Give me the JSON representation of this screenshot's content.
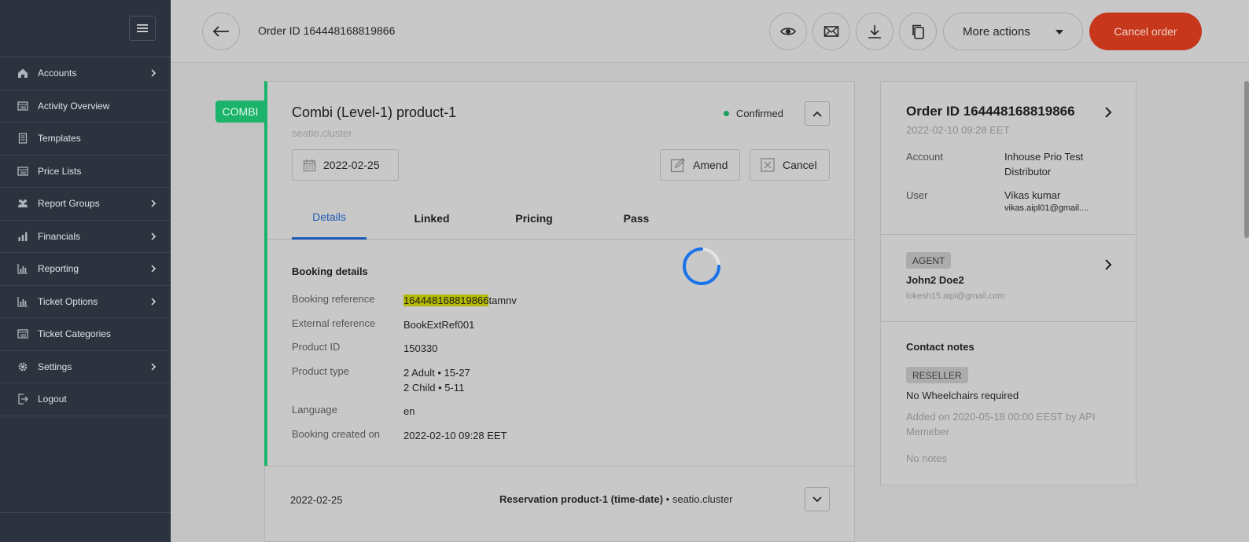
{
  "sidebar": {
    "items": [
      {
        "label": "Accounts",
        "icon": "home-icon",
        "has_children": true
      },
      {
        "label": "Activity Overview",
        "icon": "list-icon",
        "has_children": false
      },
      {
        "label": "Templates",
        "icon": "document-icon",
        "has_children": false
      },
      {
        "label": "Price Lists",
        "icon": "list-icon",
        "has_children": false
      },
      {
        "label": "Report Groups",
        "icon": "users-icon",
        "has_children": true
      },
      {
        "label": "Financials",
        "icon": "bar-chart-icon",
        "has_children": true
      },
      {
        "label": "Reporting",
        "icon": "chart-icon",
        "has_children": true
      },
      {
        "label": "Ticket Options",
        "icon": "chart-icon",
        "has_children": true
      },
      {
        "label": "Ticket Categories",
        "icon": "list-icon",
        "has_children": false
      },
      {
        "label": "Settings",
        "icon": "gear-icon",
        "has_children": true
      },
      {
        "label": "Logout",
        "icon": "logout-icon",
        "has_children": false
      }
    ]
  },
  "topbar": {
    "order_id": "Order ID 164448168819866",
    "more_actions_label": "More actions",
    "cancel_order_label": "Cancel order"
  },
  "product_card": {
    "badge": "COMBI",
    "title": "Combi (Level-1) product-1",
    "subtitle": "seatio.cluster",
    "status": "Confirmed",
    "date": "2022-02-25",
    "amend_label": "Amend",
    "cancel_label": "Cancel",
    "tabs": [
      "Details",
      "Linked",
      "Pricing",
      "Pass"
    ],
    "active_tab": "Details",
    "section_title": "Booking details",
    "details": {
      "booking_reference_label": "Booking reference",
      "booking_reference_highlight": "164448168819866",
      "booking_reference_rest": "tamnv",
      "external_reference_label": "External reference",
      "external_reference": "BookExtRef001",
      "product_id_label": "Product ID",
      "product_id": "150330",
      "product_type_label": "Product type",
      "product_type_line1": "2 Adult • 15-27",
      "product_type_line2": "2 Child • 5-11",
      "language_label": "Language",
      "language": "en",
      "created_label": "Booking created on",
      "created": "2022-02-10 09:28 EET"
    }
  },
  "second_card": {
    "date": "2022-02-25",
    "title": "Reservation product-1 (time-date)",
    "subtitle": "• seatio.cluster"
  },
  "right_panel": {
    "order_title": "Order ID 164448168819866",
    "order_date": "2022-02-10 09:28 EET",
    "account_label": "Account",
    "account_value": "Inhouse Prio Test Distributor",
    "user_label": "User",
    "user_value": "Vikas kumar",
    "user_email": "vikas.aipl01@gmail....",
    "agent_tag": "AGENT",
    "agent_name": "John2 Doe2",
    "agent_email": "lokesh15.aipl@gmail.com",
    "contact_notes_title": "Contact notes",
    "reseller_tag": "RESELLER",
    "note": "No Wheelchairs required",
    "note_added": "Added on 2020-05-18 00:00 EEST by API Memeber",
    "no_notes": "No notes"
  },
  "colors": {
    "sidebar_bg": "#2d333e",
    "accent_green": "#1bb46a",
    "cancel_red": "#c6371b",
    "link_blue": "#1b5ab5",
    "spinner_blue": "#1a73e8"
  }
}
